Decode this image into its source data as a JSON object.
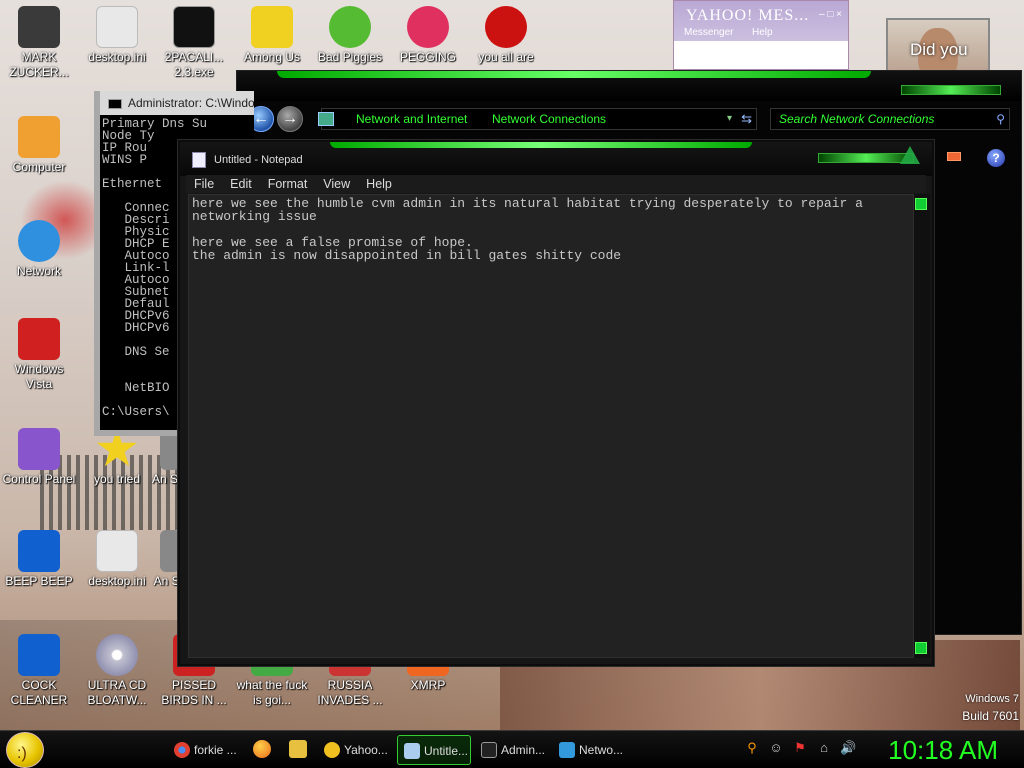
{
  "desktop": {
    "icons": [
      {
        "label": "MARK ZUCKER...",
        "icon": "figure-icon",
        "color": "#3a3a3a"
      },
      {
        "label": "desktop.ini",
        "icon": "file-icon",
        "color": "#e8e8e8"
      },
      {
        "label": "2PACALI... 2.3.exe",
        "icon": "terminal-icon",
        "color": "#111111"
      },
      {
        "label": "Among Us",
        "icon": "among-us-icon",
        "color": "#f0d020"
      },
      {
        "label": "Bad Piggies",
        "icon": "pig-icon",
        "color": "#55bb33"
      },
      {
        "label": "PEGGING",
        "icon": "p-logo-icon",
        "color": "#e03060"
      },
      {
        "label": "you all are",
        "icon": "devcpp-icon",
        "color": "#cc1111"
      },
      {
        "label": "Computer",
        "icon": "computer-icon",
        "color": "#f0a030"
      },
      {
        "label": "Network",
        "icon": "network-globe-icon",
        "color": "#3090e0"
      },
      {
        "label": "Windows Vista",
        "icon": "recycle-bin-icon",
        "color": "#d02020"
      },
      {
        "label": "Control Panel",
        "icon": "control-panel-icon",
        "color": "#8855cc"
      },
      {
        "label": "you tried",
        "icon": "star-icon",
        "color": "#f2d020"
      },
      {
        "label": "BEEP BEEP",
        "icon": "blue-panel-icon",
        "color": "#1060d0"
      },
      {
        "label": "desktop.ini",
        "icon": "file-icon",
        "color": "#e8e8e8"
      },
      {
        "label": "COCK CLEANER",
        "icon": "blue-panel-icon",
        "color": "#1060d0"
      },
      {
        "label": "ULTRA CD BLOATW...",
        "icon": "cd-icon",
        "color": "#c0c0d0"
      },
      {
        "label": "PISSED BIRDS IN ...",
        "icon": "angry-birds-icon",
        "color": "#cc2222"
      },
      {
        "label": "what the fuck is goi...",
        "icon": "shortcut-icon",
        "color": "#44aa44"
      },
      {
        "label": "RUSSIA INVADES ...",
        "icon": "shortcut-icon",
        "color": "#cc3333"
      },
      {
        "label": "XMRP",
        "icon": "shortcut-icon",
        "color": "#ee6622"
      },
      {
        "label": "do",
        "icon": "shortcut-icon",
        "color": "#888888"
      },
      {
        "label": "An Sta",
        "icon": "shortcut-icon",
        "color": "#888888"
      },
      {
        "label": "An Sh",
        "icon": "shortcut-icon",
        "color": "#888888"
      }
    ],
    "yahoo": {
      "title": "YAHOO! MES...",
      "messenger": "Messenger",
      "help": "Help",
      "controls": "– □ ×"
    },
    "photo_caption": "Did you",
    "winver_line1": "Windows 7",
    "winver_line2": "Build 7601"
  },
  "cmd_window": {
    "title": "Administrator: C:\\Windo",
    "lines": "Primary Dns Su\nNode Ty\nIP Rou\nWINS P\n\nEthernet\n\n   Connec\n   Descri\n   Physic\n   DHCP E\n   Autoco\n   Link-l\n   Autoco\n   Subnet\n   Defaul\n   DHCPv6\n   DHCPv6\n\n   DNS Se\n\n\n   NetBIO\n\nC:\\Users\\"
  },
  "explorer_window": {
    "back_glyph": "←",
    "forward_glyph": "→",
    "breadcrumb_1": "Network and Internet",
    "breadcrumb_2": "Network Connections",
    "dropdown_glyph": "▾",
    "refresh_glyph": "⇆",
    "search_placeholder": "Search Network Connections",
    "search_glyph": "⚲",
    "help_glyph": "?"
  },
  "notepad": {
    "title": "Untitled - Notepad",
    "menu": [
      "File",
      "Edit",
      "Format",
      "View",
      "Help"
    ],
    "text": "here we see the humble cvm admin in its natural habitat trying desperately to repair a\nnetworking issue\n\nhere we see a false promise of hope.\nthe admin is now disappointed in bill gates shitty code"
  },
  "taskbar": {
    "start_glyph": ":)",
    "buttons": [
      {
        "label": "forkie ...",
        "icon": "chrome-icon",
        "color": "#e04030",
        "active": false
      },
      {
        "label": "Yahoo...",
        "icon": "yahoo-smiley-icon",
        "color": "#f0c020",
        "active": false
      },
      {
        "label": "Untitle...",
        "icon": "notepad-icon",
        "color": "#aaccee",
        "active": true
      },
      {
        "label": "Admin...",
        "icon": "cmd-icon",
        "color": "#222222",
        "active": false
      },
      {
        "label": "Netwo...",
        "icon": "network-connections-icon",
        "color": "#3399dd",
        "active": false
      }
    ],
    "quick_launch": [
      {
        "icon": "firefox-icon",
        "color": "#e86a1a"
      },
      {
        "icon": "folder-icon",
        "color": "#e8c040"
      }
    ],
    "tray": [
      "⚲",
      "☺",
      "⚑",
      "⌂",
      "🔊"
    ],
    "clock": "10:18 AM"
  }
}
